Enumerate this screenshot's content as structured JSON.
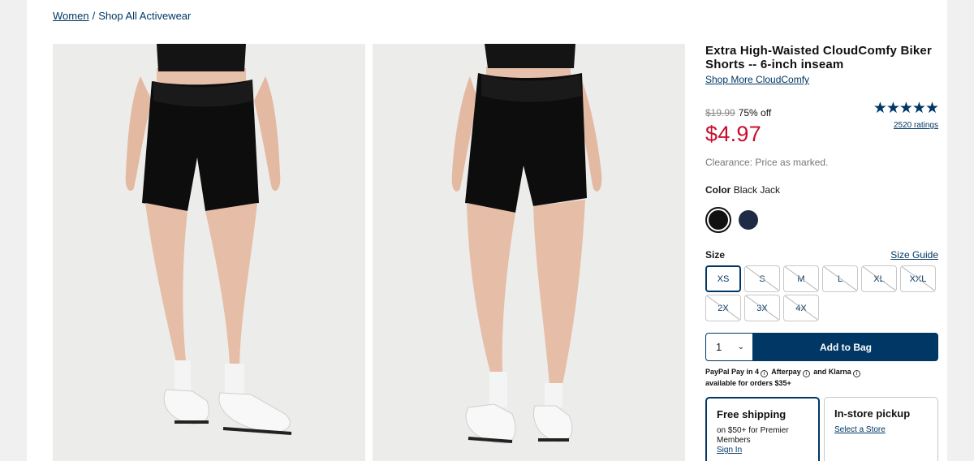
{
  "breadcrumb": {
    "parent": "Women",
    "separator": "/",
    "current": "Shop All Activewear"
  },
  "product": {
    "title": "Extra High-Waisted CloudComfy Biker Shorts -- 6-inch inseam",
    "shop_more": "Shop More CloudComfy",
    "original_price": "$19.99",
    "discount": "75% off",
    "sale_price": "$4.97",
    "clearance_note": "Clearance: Price as marked.",
    "stars": "★★★★★",
    "rating_value": 4.7,
    "ratings_count": "2520 ratings"
  },
  "color": {
    "label": "Color",
    "selected_name": "Black Jack",
    "swatches": [
      {
        "name": "Black Jack",
        "hex": "#111111",
        "selected": true
      },
      {
        "name": "Navy",
        "hex": "#1f2a44",
        "selected": false
      }
    ]
  },
  "size": {
    "label": "Size",
    "guide_link": "Size Guide",
    "options": [
      {
        "label": "XS",
        "available": true,
        "selected": true
      },
      {
        "label": "S",
        "available": false,
        "selected": false
      },
      {
        "label": "M",
        "available": false,
        "selected": false
      },
      {
        "label": "L",
        "available": false,
        "selected": false
      },
      {
        "label": "XL",
        "available": false,
        "selected": false
      },
      {
        "label": "XXL",
        "available": false,
        "selected": false
      },
      {
        "label": "2X",
        "available": false,
        "selected": false
      },
      {
        "label": "3X",
        "available": false,
        "selected": false
      },
      {
        "label": "4X",
        "available": false,
        "selected": false
      }
    ]
  },
  "purchase": {
    "quantity": "1",
    "add_to_bag": "Add to Bag"
  },
  "paylater": {
    "paypal": "PayPal Pay in 4",
    "afterpay": "Afterpay",
    "and": "and",
    "klarna": "Klarna",
    "note": "available for orders $35+"
  },
  "fulfillment": {
    "shipping": {
      "title": "Free shipping",
      "subtitle": "on $50+ for Premier Members",
      "link": "Sign In"
    },
    "pickup": {
      "title": "In-store pickup",
      "link": "Select a Store"
    }
  },
  "colors": {
    "accent": "#003764",
    "sale": "#c8102e",
    "background": "#f0f0f0"
  }
}
